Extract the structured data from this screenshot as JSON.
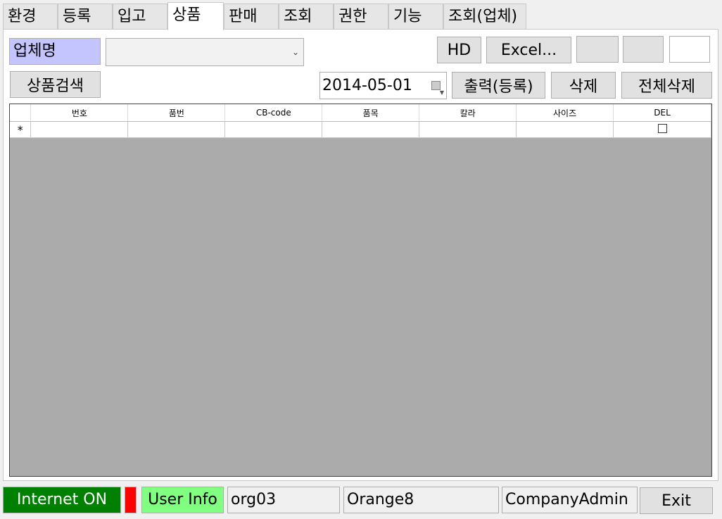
{
  "tabs": [
    "환경",
    "등록",
    "입고",
    "상품",
    "판매",
    "조회",
    "권한",
    "기능",
    "조회(업체)"
  ],
  "active_tab": "상품",
  "toolbar": {
    "vendor_label": "업체명",
    "vendor_combo_value": "",
    "hd_label": "HD",
    "excel_label": "Excel...",
    "blank_btn_1": "",
    "blank_btn_2": "",
    "blank_btn_3": "",
    "search_label": "상품검색",
    "date_value": "2014-05-01",
    "print_label": "출력(등록)",
    "delete_label": "삭제",
    "delete_all_label": "전체삭제"
  },
  "grid": {
    "columns": [
      "번호",
      "품번",
      "CB-code",
      "품목",
      "칼라",
      "사이즈",
      "DEL"
    ],
    "new_row_marker": "*"
  },
  "statusbar": {
    "internet": "Internet ON",
    "user_info": "User Info",
    "user_id": "org03",
    "user_name": "Orange8",
    "role": "CompanyAdmin",
    "exit": "Exit"
  },
  "colors": {
    "internet_bg": "#008000",
    "indicator": "#ff0000",
    "user_info_bg": "#80ff80",
    "vendor_label_bg": "#c4c4ff",
    "grid_bg": "#ababab"
  }
}
